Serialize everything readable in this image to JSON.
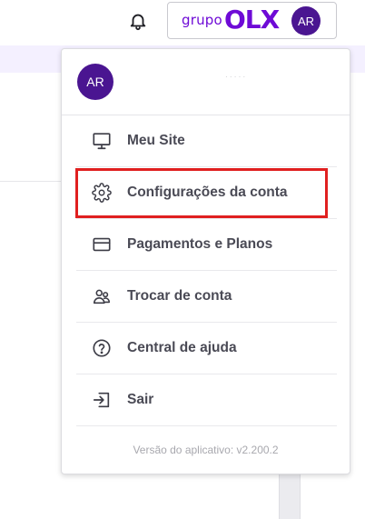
{
  "header": {
    "brand_prefix": "grupo",
    "brand_name": "OLX",
    "avatar_initials": "AR",
    "accent_color": "#6e0ad6"
  },
  "menu": {
    "avatar_initials": "AR",
    "user_name": "· · · · ·",
    "items": [
      {
        "label": "Meu Site",
        "icon": "monitor-icon"
      },
      {
        "label": "Configurações da conta",
        "icon": "gear-icon"
      },
      {
        "label": "Pagamentos e Planos",
        "icon": "credit-card-icon"
      },
      {
        "label": "Trocar de conta",
        "icon": "users-icon"
      },
      {
        "label": "Central de ajuda",
        "icon": "help-circle-icon"
      },
      {
        "label": "Sair",
        "icon": "logout-icon"
      }
    ],
    "version_text": "Versão do aplicativo: v2.200.2"
  }
}
